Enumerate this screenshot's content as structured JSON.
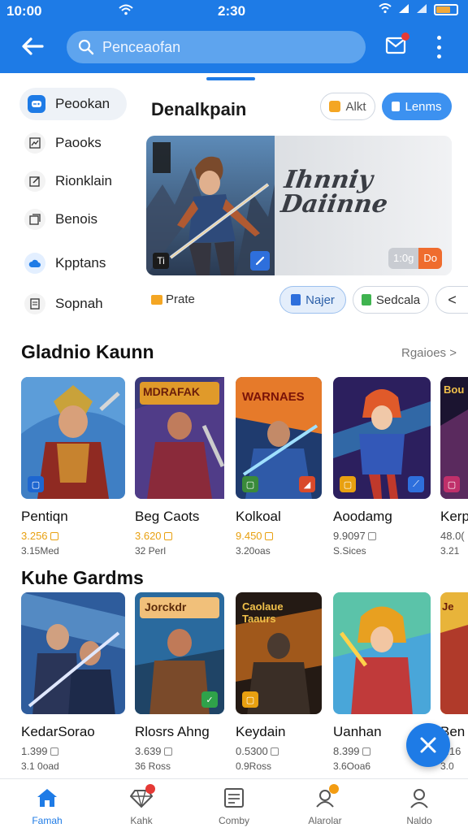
{
  "status_bar": {
    "time_left": "10:00",
    "time_center": "2:30"
  },
  "app_bar": {
    "search_placeholder": "Penceaofan"
  },
  "sidebar": {
    "items": [
      {
        "label": "Peookan",
        "icon": "controller-icon",
        "active": true
      },
      {
        "label": "Paooks",
        "icon": "chart-icon"
      },
      {
        "label": "Rionklain",
        "icon": "edit-icon"
      },
      {
        "label": "Benois",
        "icon": "gallery-icon"
      },
      {
        "label": "Kpptans",
        "icon": "cloud-icon"
      },
      {
        "label": "Sopnah",
        "icon": "document-icon"
      }
    ]
  },
  "featured": {
    "title": "Denalkpain",
    "chip_alt": "Alkt",
    "chip_primary": "Lenms",
    "banner_logo_line1": "Ihnniy",
    "banner_logo_line2": "Daiinne",
    "banner_badge": "Ti",
    "price_old": "1:0g",
    "price_new": "Do",
    "caption": "Prate",
    "pill_player": "Najer",
    "pill_schedule": "Sedcala",
    "pill_more": "<"
  },
  "section1": {
    "title": "Gladnio Kaunn",
    "see_all": "Rgaioes >",
    "games": [
      {
        "name": "Pentiqn",
        "price": "3.256",
        "meta": "3.15Med",
        "price_color": "orange",
        "banner": ""
      },
      {
        "name": "Beg Caots",
        "price": "3.620",
        "meta": "32 Perl",
        "price_color": "orange",
        "banner": "MDRAFAK"
      },
      {
        "name": "Kolkoal",
        "price": "9.450",
        "meta": "3.20oas",
        "price_color": "orange",
        "banner": "WARNAES"
      },
      {
        "name": "Aoodamg",
        "price": "9.9097",
        "meta": "S.Sices",
        "price_color": "gray",
        "banner": ""
      },
      {
        "name": "Kerp",
        "price": "48.0(",
        "meta": "3.21",
        "price_color": "gray",
        "banner": "Bou"
      }
    ]
  },
  "section2": {
    "title": "Kuhe Gardms",
    "games": [
      {
        "name": "KedarSorao",
        "price": "1.399",
        "meta": "3.1 0oad",
        "price_color": "gray",
        "banner": ""
      },
      {
        "name": "Rlosrs Ahng",
        "price": "3.639",
        "meta": "36 Ross",
        "price_color": "gray",
        "banner": "Jorckdr"
      },
      {
        "name": "Keydain",
        "price": "0.5300",
        "meta": "0.9Ross",
        "price_color": "gray",
        "banner": "Caolaue Taaurs"
      },
      {
        "name": "Uanhan",
        "price": "8.399",
        "meta": "3.6Ooa6",
        "price_color": "gray",
        "banner": ""
      },
      {
        "name": "Ben",
        "price": "3.16",
        "meta": "3.0",
        "price_color": "gray",
        "banner": "Je"
      }
    ]
  },
  "bottom_nav": {
    "items": [
      {
        "label": "Famah",
        "icon": "home-icon",
        "active": true
      },
      {
        "label": "Kahk",
        "icon": "gem-icon",
        "badge": "red"
      },
      {
        "label": "Comby",
        "icon": "list-icon"
      },
      {
        "label": "Alarolar",
        "icon": "profile-pin-icon",
        "badge": "orange"
      },
      {
        "label": "Naldo",
        "icon": "person-icon"
      }
    ]
  },
  "colors": {
    "primary": "#1e7be6",
    "accent_orange": "#ef6c2e",
    "price_gold": "#e8a010"
  },
  "battery_level": 0.7
}
